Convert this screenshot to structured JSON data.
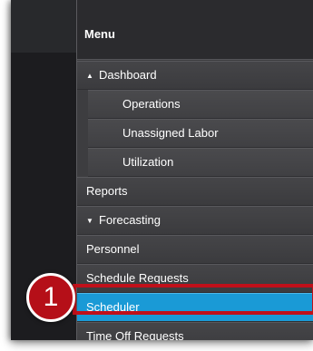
{
  "menu": {
    "header": "Menu",
    "items": [
      {
        "label": "Dashboard",
        "caret": "▲"
      },
      {
        "label": "Operations"
      },
      {
        "label": "Unassigned Labor"
      },
      {
        "label": "Utilization"
      },
      {
        "label": "Reports"
      },
      {
        "label": "Forecasting",
        "caret": "▼"
      },
      {
        "label": "Personnel"
      },
      {
        "label": "Schedule Requests"
      },
      {
        "label": "Scheduler",
        "active": true
      },
      {
        "label": "Time Off Requests"
      }
    ]
  },
  "callout": {
    "number": "1"
  },
  "colors": {
    "active": "#1a9ad6",
    "callout": "#b50f18"
  }
}
